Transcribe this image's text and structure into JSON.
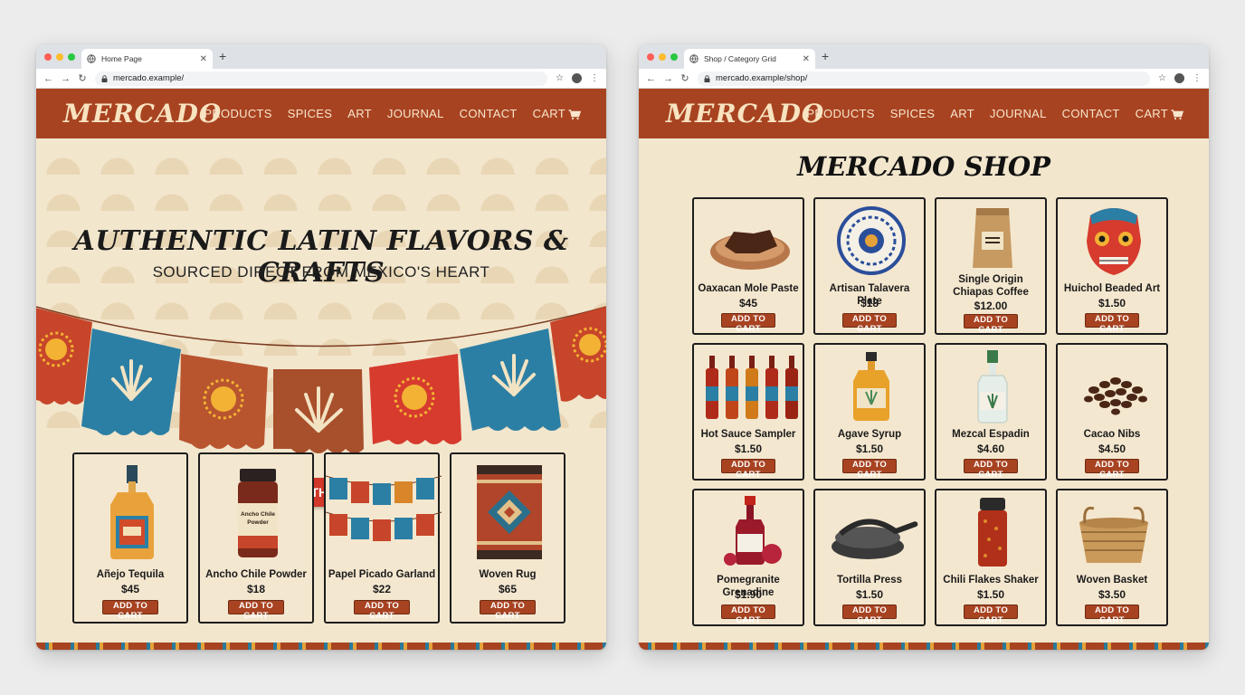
{
  "left": {
    "tab_title": "Home Page",
    "url": "mercado.example/",
    "logo": "MERCADO",
    "nav": [
      "PRODUCTS",
      "SPICES",
      "ART",
      "JOURNAL",
      "CONTACT",
      "CART"
    ],
    "hero_title": "AUTHENTIC LATIN FLAVORS & CRAFTS",
    "hero_subtitle": "SOURCED DIRECT FROM MEXICO'S HEART",
    "cta": "EXPLORE THE MARKET",
    "products": [
      {
        "name": "Añejo Tequila",
        "price": "$45",
        "button": "ADD TO CART"
      },
      {
        "name": "Ancho Chile Powder",
        "price": "$18",
        "button": "ADD TO CART"
      },
      {
        "name": "Papel Picado Garland",
        "price": "$22",
        "button": "ADD TO CART"
      },
      {
        "name": "Woven Rug",
        "price": "$65",
        "button": "ADD TO CART"
      }
    ]
  },
  "right": {
    "tab_title": "Shop / Category Grid",
    "url": "mercado.example/shop/",
    "logo": "MERCADO",
    "nav": [
      "PRODUCTS",
      "SPICES",
      "ART",
      "JOURNAL",
      "CONTACT",
      "CART"
    ],
    "shop_title": "MERCADO SHOP",
    "products": [
      {
        "name": "Oaxacan Mole Paste",
        "price": "$45",
        "button": "ADD TO CART"
      },
      {
        "name": "Artisan Talavera Plate",
        "price": "$18",
        "button": "ADD TO CART"
      },
      {
        "name": "Single Origin Chiapas Coffee",
        "price": "$12.00",
        "button": "ADD TO CART"
      },
      {
        "name": "Huichol Beaded Art",
        "price": "$1.50",
        "button": "ADD TO CART"
      },
      {
        "name": "Hot Sauce Sampler",
        "price": "$1.50",
        "button": "ADD TO CART"
      },
      {
        "name": "Agave Syrup",
        "price": "$1.50",
        "button": "ADD TO CART"
      },
      {
        "name": "Mezcal Espadin",
        "price": "$4.60",
        "button": "ADD TO CART"
      },
      {
        "name": "Cacao Nibs",
        "price": "$4.50",
        "button": "ADD TO CART"
      },
      {
        "name": "Pomegranite Grenadine",
        "price": "$1.90",
        "button": "ADD TO CART"
      },
      {
        "name": "Tortilla Press",
        "price": "$1.50",
        "button": "ADD TO CART"
      },
      {
        "name": "Chili Flakes Shaker",
        "price": "$1.50",
        "button": "ADD TO CART"
      },
      {
        "name": "Woven Basket",
        "price": "$3.50",
        "button": "ADD TO CART"
      }
    ]
  },
  "icons": {
    "tab_favicon": "globe-icon",
    "lock": "lock-icon",
    "cart": "cart-icon",
    "bookmark": "star-icon",
    "account": "account-icon",
    "more": "more-icon"
  },
  "colors": {
    "header": "#a84321",
    "page_bg": "#f2e6cd",
    "cta": "#d1382a",
    "button": "#a84321"
  }
}
